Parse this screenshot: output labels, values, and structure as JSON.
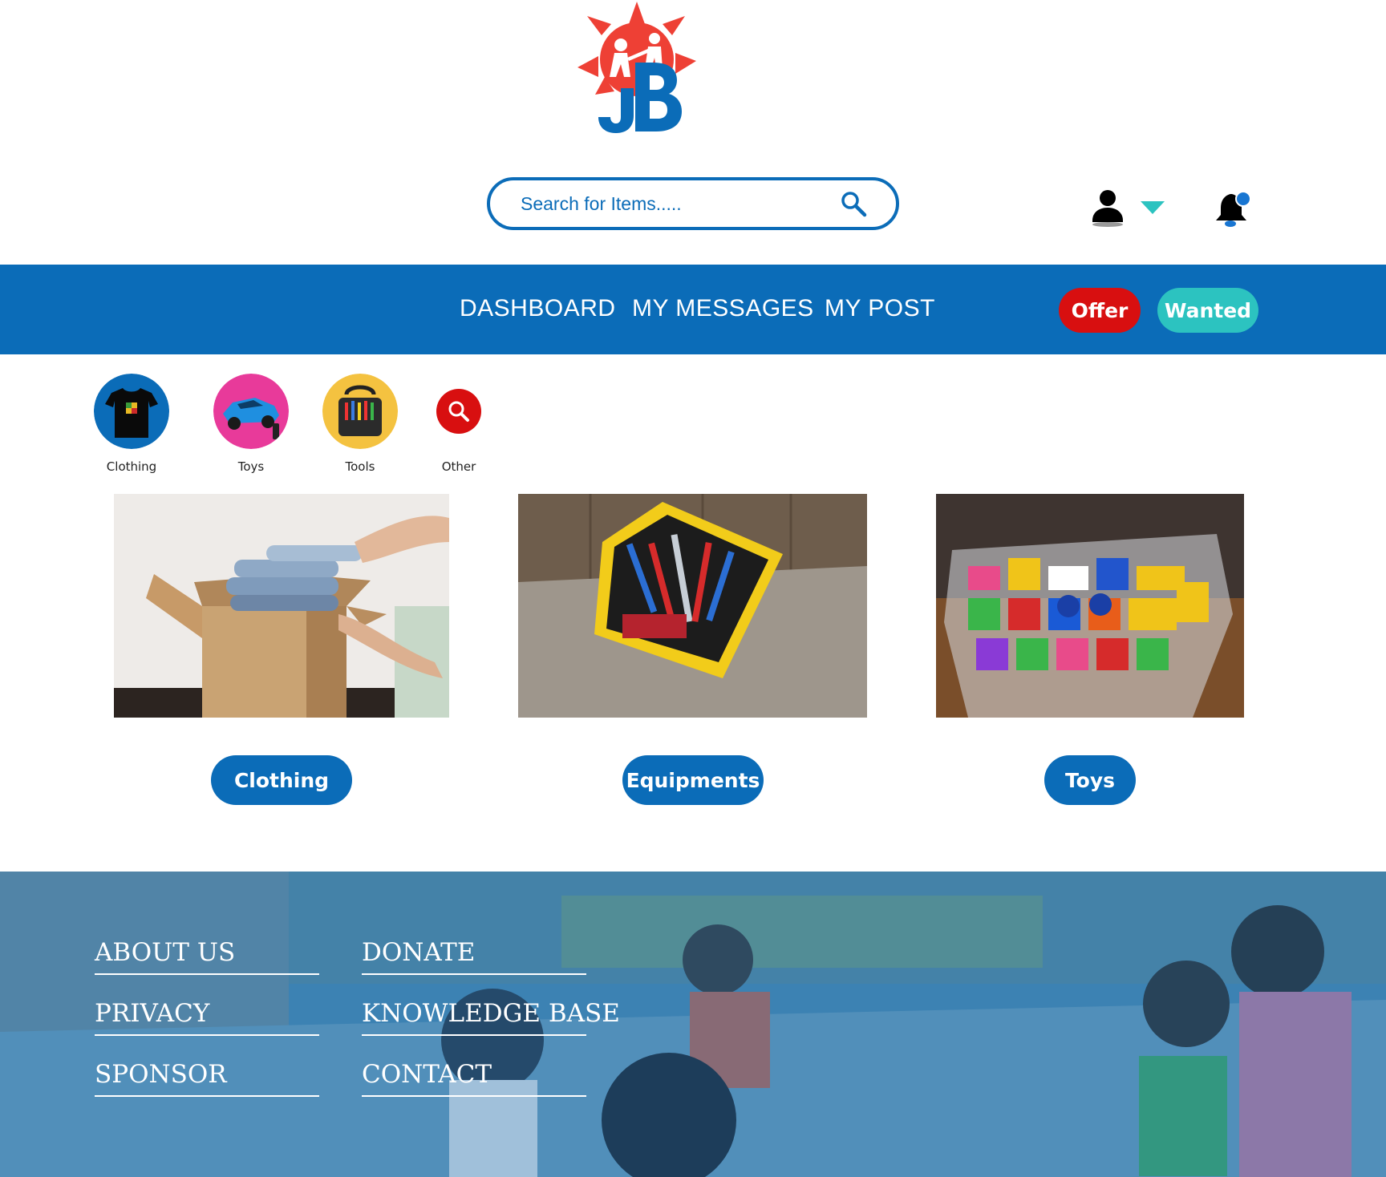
{
  "header": {
    "logo_icon": "jb-sun-logo",
    "search": {
      "placeholder": "Search for Items.....",
      "value": "",
      "icon": "search-icon"
    },
    "user_icon": "user-icon",
    "dropdown_icon": "caret-down-icon",
    "notification_icon": "bell-icon"
  },
  "nav": {
    "links": [
      {
        "label": "DASHBOARD"
      },
      {
        "label": "MY MESSAGES"
      },
      {
        "label": "MY POST"
      }
    ],
    "offer_label": "Offer",
    "wanted_label": "Wanted"
  },
  "categories": [
    {
      "label": "Clothing",
      "icon": "tshirt-icon"
    },
    {
      "label": "Toys",
      "icon": "rc-car-icon"
    },
    {
      "label": "Tools",
      "icon": "tool-bag-icon"
    },
    {
      "label": "Other",
      "icon": "search-icon"
    }
  ],
  "tiles": [
    {
      "label": "Clothing",
      "image": "clothes-box-photo"
    },
    {
      "label": "Equipments",
      "image": "toolbox-photo"
    },
    {
      "label": "Toys",
      "image": "toy-bin-photo"
    }
  ],
  "footer": {
    "background": "children-photo",
    "col1": [
      {
        "label": "ABOUT US"
      },
      {
        "label": "PRIVACY"
      },
      {
        "label": "SPONSOR"
      }
    ],
    "col2": [
      {
        "label": "DONATE"
      },
      {
        "label": "KNOWLEDGE BASE"
      },
      {
        "label": "CONTACT"
      }
    ]
  },
  "colors": {
    "primary_blue": "#0b6cb8",
    "offer_red": "#d80f10",
    "wanted_teal": "#2cc3c0",
    "logo_red": "#ee4035",
    "notification_dot": "#1976d2"
  }
}
